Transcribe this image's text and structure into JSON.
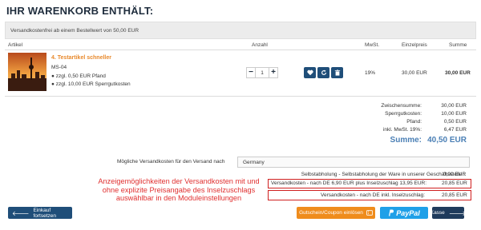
{
  "page_title": "IHR WARENKORB ENTHÄLT:",
  "notice": "Versandkostenfrei ab einem Bestellwert von 50,00 EUR",
  "columns": {
    "article": "Artikel",
    "quantity": "Anzahl",
    "vat": "MwSt.",
    "unit_price": "Einzelpreis",
    "total": "Summe"
  },
  "item": {
    "name": "4. Testartikel schneller",
    "sku": "MS-04",
    "extras": [
      "zzgl. 0,50 EUR Pfand",
      "zzgl. 10,00 EUR Sperrgutkosten"
    ],
    "quantity": "1",
    "vat": "19%",
    "unit_price": "30,00 EUR",
    "total": "30,00 EUR"
  },
  "summary": {
    "subtotal_label": "Zwischensumme:",
    "subtotal": "30,00 EUR",
    "bulky_label": "Sperrgutkosten:",
    "bulky": "10,00 EUR",
    "deposit_label": "Pfand:",
    "deposit": "0,50 EUR",
    "vat_label": "inkl. MwSt. 19%:",
    "vat": "6,47 EUR",
    "sum_label": "Summe:",
    "sum": "40,50 EUR"
  },
  "shipping": {
    "label": "Mögliche Versandkosten für den Versand nach",
    "country": "Germany",
    "options": [
      {
        "label": "Selbstabholung - Selbstabholung der Ware in unserer Geschäftsstelle.:",
        "price": "0,00 EUR"
      },
      {
        "label": "Versandkosten - nach DE 6,90 EUR plus Inselzuschlag 13,95 EUR:",
        "price": "20,85 EUR"
      },
      {
        "label": "Versandkosten - nach DE inkl. Inselzuschlag:",
        "price": "20,85 EUR"
      }
    ]
  },
  "annotation": [
    "Anzeigemöglichkeiten der Versandkosten mit und",
    "ohne explizite Preisangabe des Inselzuschlags",
    "auswählbar in den Moduleinstellungen"
  ],
  "buttons": {
    "back": "Einkauf fortsetzen",
    "coupon": "Gutschein/Coupon einlösen",
    "paypal": "PayPal",
    "checkout": "Kasse"
  },
  "colors": {
    "primary": "#1f4e79",
    "accent": "#e8892c",
    "annotation": "#e03030",
    "paypal": "#1fa0e8"
  }
}
